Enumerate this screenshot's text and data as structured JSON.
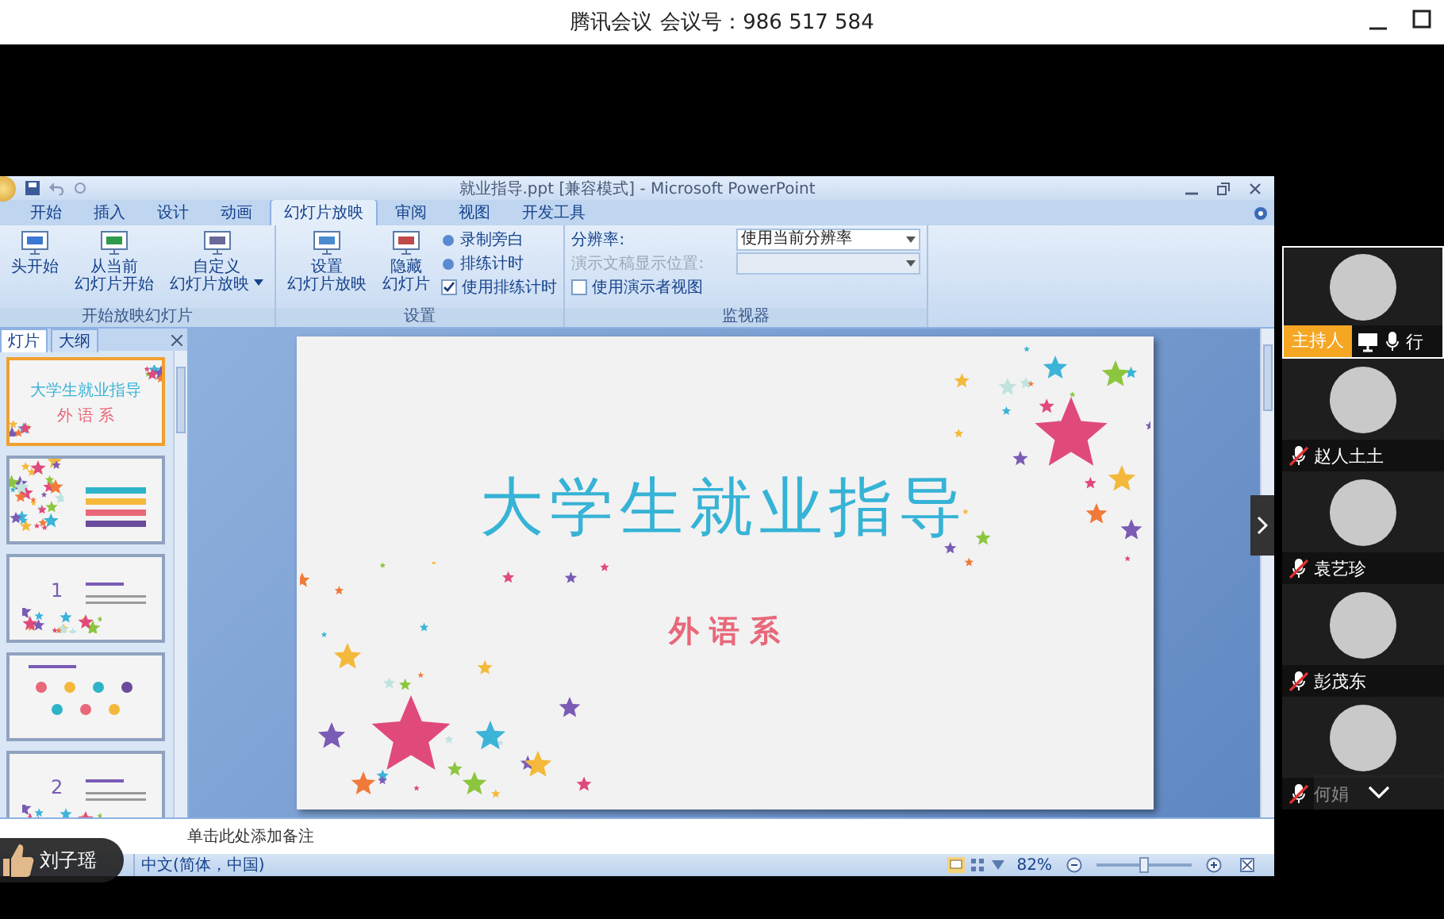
{
  "meeting": {
    "app_name": "腾讯会议",
    "meeting_number": "会议号：986 517 584"
  },
  "ppt": {
    "title": "就业指导.ppt [兼容模式] - Microsoft PowerPoint",
    "tabs": [
      {
        "label": "开始",
        "selected": false
      },
      {
        "label": "插入",
        "selected": false
      },
      {
        "label": "设计",
        "selected": false
      },
      {
        "label": "动画",
        "selected": false
      },
      {
        "label": "幻灯片放映",
        "selected": true
      },
      {
        "label": "审阅",
        "selected": false
      },
      {
        "label": "视图",
        "selected": false
      },
      {
        "label": "开发工具",
        "selected": false
      }
    ],
    "ribbon": [
      {
        "label": "开始放映幻灯片",
        "items": [
          {
            "kind": "large",
            "lines": [
              "头开始"
            ]
          },
          {
            "kind": "large",
            "lines": [
              "从当前",
              "幻灯片开始"
            ]
          },
          {
            "kind": "large_menu",
            "lines": [
              "自定义",
              "幻灯片放映"
            ]
          }
        ]
      },
      {
        "label": "设置",
        "items": [
          {
            "kind": "large",
            "lines": [
              "设置",
              "幻灯片放映"
            ]
          },
          {
            "kind": "large",
            "lines": [
              "隐藏",
              "幻灯片"
            ]
          },
          {
            "kind": "small",
            "label": "录制旁白"
          },
          {
            "kind": "small",
            "label": "排练计时"
          },
          {
            "kind": "check",
            "label": "使用排练计时",
            "checked": true
          }
        ]
      },
      {
        "label": "监视器",
        "items": [
          {
            "kind": "select",
            "label": "分辨率:",
            "value": "使用当前分辨率",
            "disabled": false
          },
          {
            "kind": "select",
            "label": "演示文稿显示位置:",
            "disabled": true
          },
          {
            "kind": "check",
            "label": "使用演示者视图",
            "checked": false
          }
        ]
      }
    ],
    "pane_tabs": [
      {
        "label": "灯片",
        "selected": true
      },
      {
        "label": "大纲",
        "selected": false
      }
    ],
    "thumbnails": [
      {
        "kind": "cover",
        "selected": true,
        "title": "大学生就业指导",
        "subtitle": "外 语 系"
      },
      {
        "kind": "agenda",
        "selected": false
      },
      {
        "kind": "section",
        "selected": false,
        "number": "1"
      },
      {
        "kind": "icons",
        "selected": false
      },
      {
        "kind": "section",
        "selected": false,
        "number": "2"
      }
    ],
    "slide": {
      "title": "大学生就业指导",
      "subtitle": "外 语 系"
    },
    "notes": {
      "placeholder": "单击此处添加备注"
    },
    "status_bar": {
      "language": "中文(简体，中国)",
      "zoom": "82%",
      "zoom_level": {
        "level": 0.5
      }
    }
  },
  "participants": [
    {
      "kind": "host",
      "badge": "主持人",
      "name": "行",
      "muted": false
    },
    {
      "kind": "member",
      "name": "赵人土土",
      "muted": true
    },
    {
      "kind": "member",
      "name": "袁艺珍",
      "muted": true
    },
    {
      "kind": "member",
      "name": "彭茂东",
      "muted": true
    },
    {
      "kind": "member",
      "name": "何娟",
      "muted": true
    }
  ],
  "reaction": {
    "name": "刘子瑶"
  }
}
